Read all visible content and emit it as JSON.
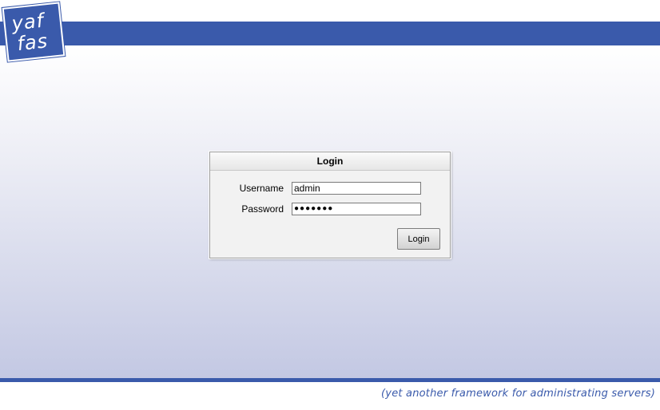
{
  "logo": {
    "line1": "yaf",
    "line2": "fas"
  },
  "login": {
    "title": "Login",
    "username_label": "Username",
    "username_value": "admin",
    "password_label": "Password",
    "password_value": "●●●●●●●",
    "submit_label": "Login"
  },
  "footer": {
    "tagline": "(yet another framework for administrating servers)"
  },
  "colors": {
    "brand": "#3a5aab",
    "gradient_top": "#ffffff",
    "gradient_bottom": "#c3c8e3"
  }
}
